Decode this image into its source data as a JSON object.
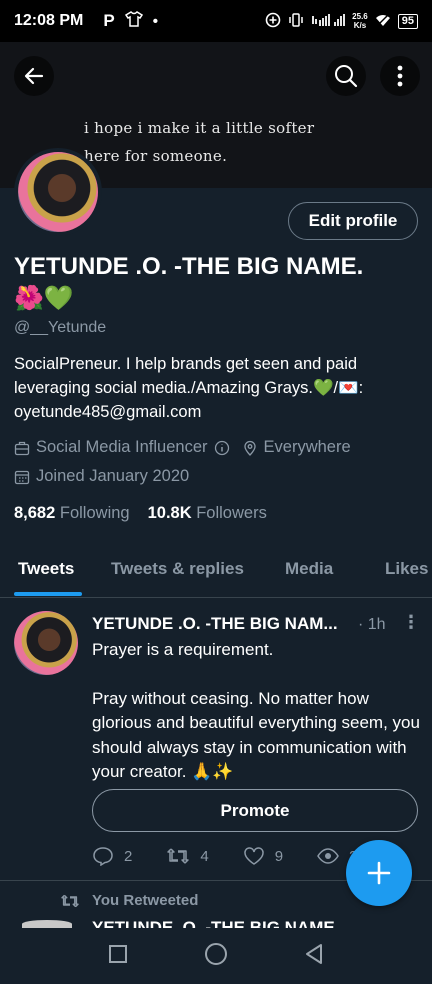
{
  "status_bar": {
    "time": "12:08 PM",
    "carrier_icon": "P",
    "network": "4G",
    "speed_value": "25.6",
    "speed_unit": "K/s",
    "battery": "95"
  },
  "banner": {
    "quote_line1": "i hope i make it a little softer",
    "quote_line2": "here for someone."
  },
  "profile": {
    "edit_label": "Edit profile",
    "name": "YETUNDE .O. -THE BIG NAME.",
    "name_emojis": "🌺💚",
    "handle": "@__Yetunde",
    "bio": "SocialPreneur. I help brands get seen and paid leveraging social media./Amazing Grays.💚/💌: oyetunde485@gmail.com",
    "category": "Social Media Influencer",
    "location": "Everywhere",
    "joined": "Joined January 2020",
    "following_count": "8,682",
    "following_label": "Following",
    "followers_count": "10.8K",
    "followers_label": "Followers"
  },
  "tabs": [
    "Tweets",
    "Tweets & replies",
    "Media",
    "Likes"
  ],
  "tweet": {
    "name": "YETUNDE .O. -THE BIG NAM...",
    "time": "· 1h",
    "text_line1": "Prayer is a requirement.",
    "text_rest": "Pray without ceasing. No matter how glorious and beautiful everything seem, you should always stay in communication with your creator. 🙏✨",
    "promote_label": "Promote",
    "replies": "2",
    "retweets": "4",
    "likes": "9",
    "views": "29"
  },
  "retweet_banner": "You Retweeted",
  "next_tweet_name": "YETUNDE .O. -THE BIG NAME.",
  "colors": {
    "accent": "#1d9bf0",
    "background": "#15202b",
    "muted": "#8b98a5"
  }
}
